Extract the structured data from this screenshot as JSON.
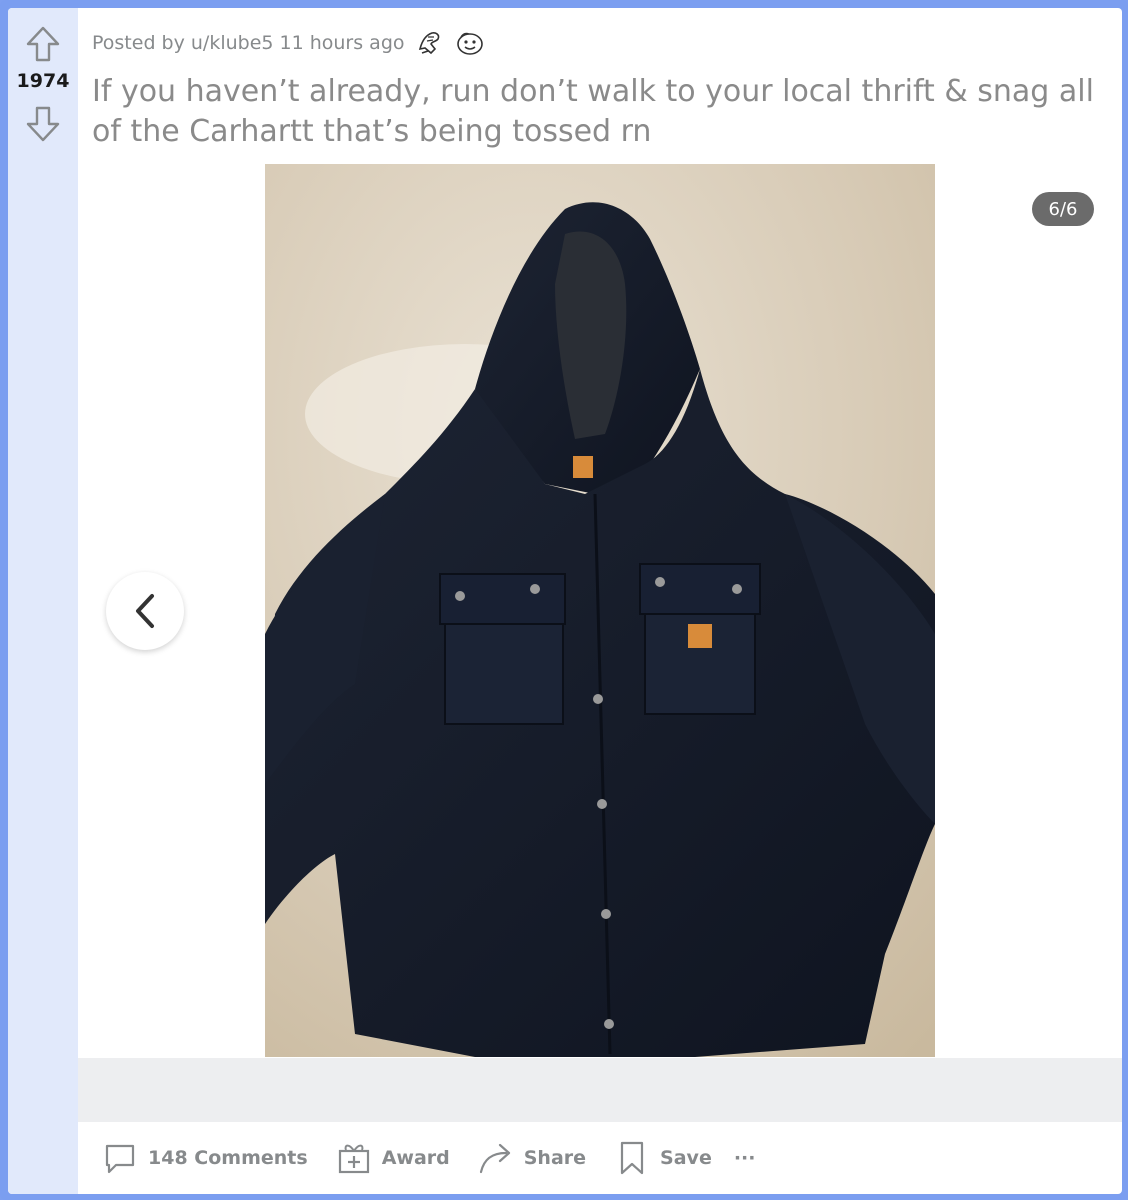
{
  "post": {
    "score": "1974",
    "posted_by": "Posted by u/klube5",
    "time_ago": "11 hours ago",
    "title": "If you haven’t already, run don’t walk to your local thrift & snag all of the Carhartt that’s being tossed rn",
    "awards": [
      "helpful-award-icon",
      "wholesome-award-icon"
    ]
  },
  "gallery": {
    "counter": "6/6",
    "image_description": "navy Carhartt hooded jacket on carpet"
  },
  "actions": {
    "comments_label": "148 Comments",
    "award_label": "Award",
    "share_label": "Share",
    "save_label": "Save",
    "more_label": "···"
  },
  "colors": {
    "frame": "#7b9ef0",
    "vote_column": "#e1e9fb",
    "muted_text": "#878a8c",
    "counter_bg": "#6b6b6b"
  }
}
